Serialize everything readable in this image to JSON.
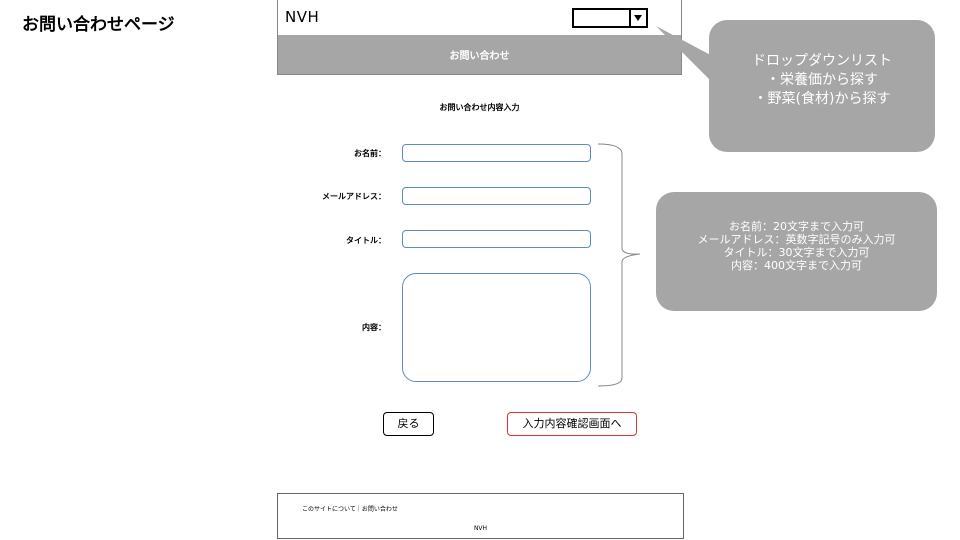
{
  "page_label": "お問い合わせページ",
  "header": {
    "site_name": "NVH"
  },
  "nav": {
    "label": "お問い合わせ"
  },
  "form": {
    "title": "お問い合わせ内容入力",
    "fields": [
      {
        "label": "お名前："
      },
      {
        "label": "メールアドレス："
      },
      {
        "label": "タイトル："
      },
      {
        "label": "内容："
      }
    ],
    "back_label": "戻る",
    "confirm_label": "入力内容確認画面へ"
  },
  "callouts": {
    "dropdown": [
      "ドロップダウンリスト",
      "・栄養価から探す",
      "・野菜(食材)から探す"
    ],
    "fields": [
      "お名前：20文字まで入力可",
      "メールアドレス：英数字記号のみ入力可",
      "タイトル：30文字まで入力可",
      "内容：400文字まで入力可"
    ]
  },
  "footer": {
    "links": "このサイトについて｜お問い合わせ",
    "site_name": "NVH"
  },
  "colors": {
    "nav_bg": "#a6a6a6",
    "callout_bg": "#a6a6a6",
    "input_border": "#5b8bc9",
    "confirm_border": "#e03030"
  }
}
